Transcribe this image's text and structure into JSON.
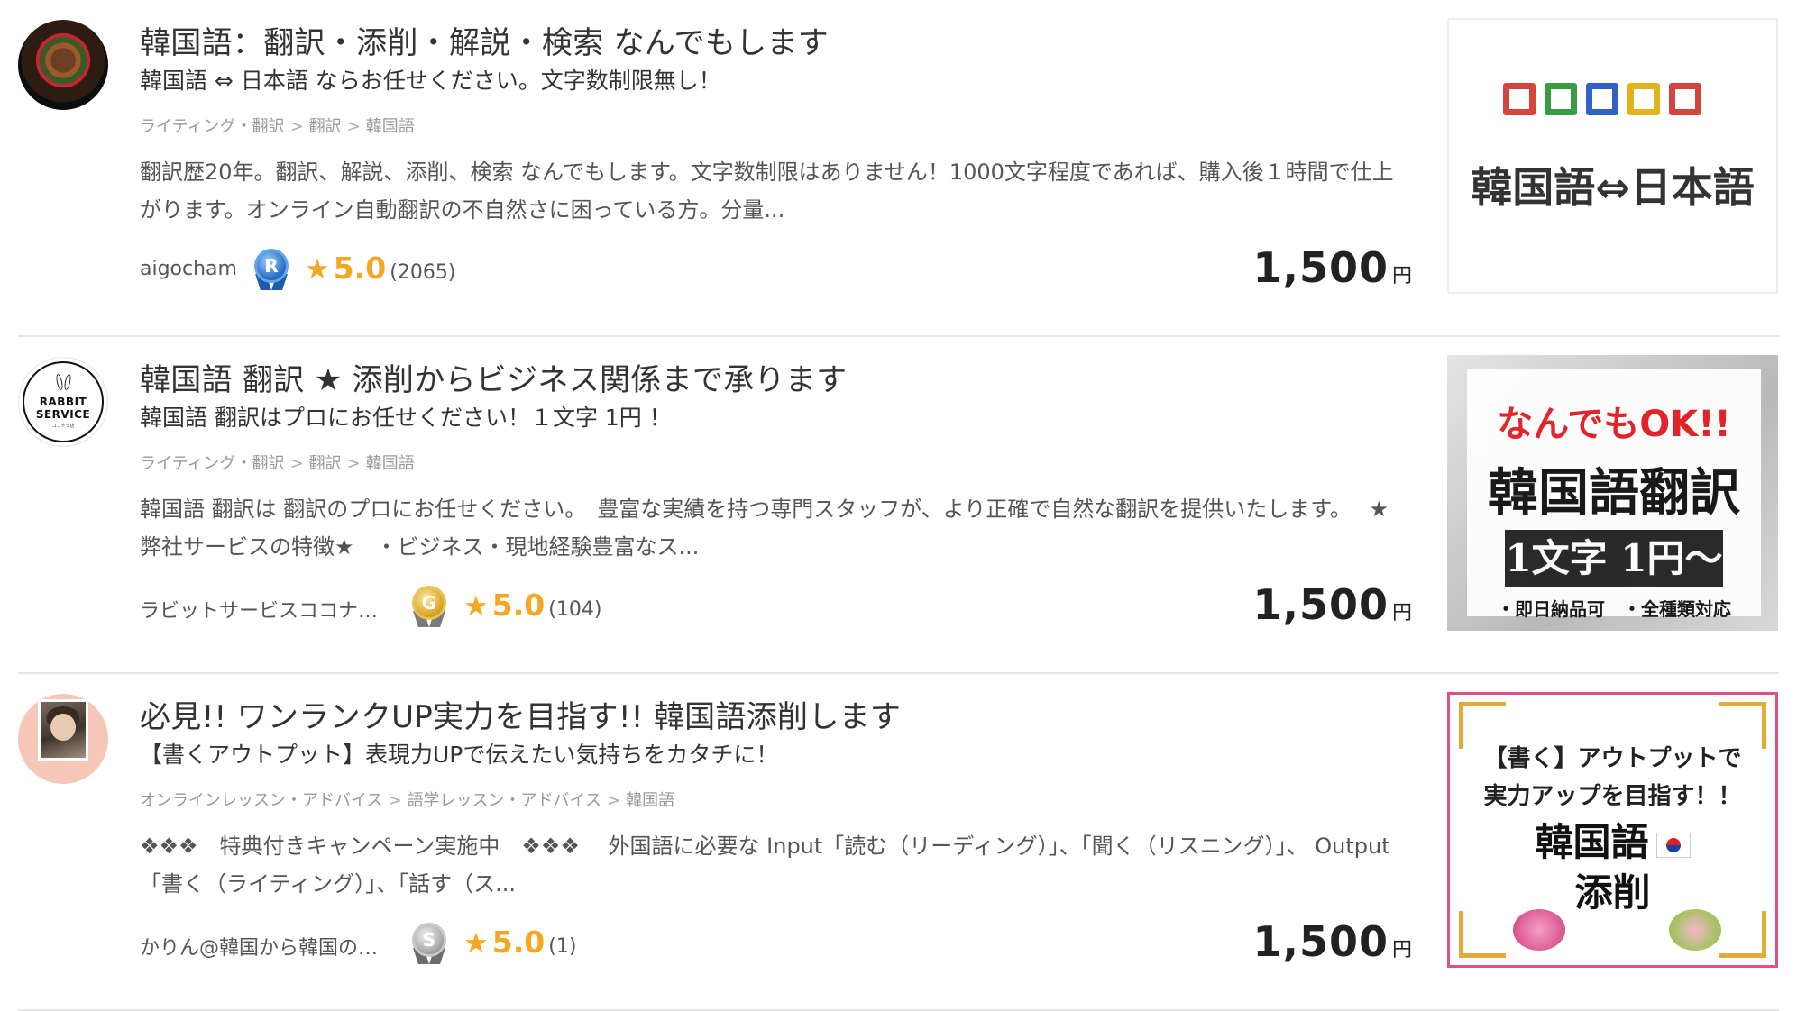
{
  "listings": [
    {
      "title": "韓国語：翻訳・添削・解説・検索 なんでもします",
      "subtitle": "韓国語 ⇔ 日本語 ならお任せください。文字数制限無し！",
      "breadcrumb": [
        "ライティング・翻訳",
        "翻訳",
        "韓国語"
      ],
      "description": "翻訳歴20年。翻訳、解説、添削、検索 なんでもします。文字数制限はありません！1000文字程度であれば、購入後１時間で仕上がります。オンライン自動翻訳の不自然さに困っている方。分量...",
      "seller": "aigocham",
      "medal_letter": "R",
      "rating": "5.0",
      "review_count": "(2065)",
      "price": "1,500",
      "currency": "円",
      "thumbnail_text": "韓国語⇔日本語"
    },
    {
      "title": "韓国語 翻訳 ★ 添削からビジネス関係まで承ります",
      "subtitle": "韓国語 翻訳はプロにお任せください！１文字 1円 ！",
      "breadcrumb": [
        "ライティング・翻訳",
        "翻訳",
        "韓国語"
      ],
      "description": "韓国語 翻訳は 翻訳のプロにお任せください。　豊富な実績を持つ専門スタッフが、より正確で自然な翻訳を提供いたします。　 ★弊社サービスの特徴★　・ビジネス・現地経験豊富なス...",
      "seller": "ラビットサービスココナ…",
      "medal_letter": "G",
      "rating": "5.0",
      "review_count": "(104)",
      "price": "1,500",
      "currency": "円",
      "avatar_text": [
        "RABBIT",
        "SERVICE",
        "ココナラ店"
      ],
      "thumbnail_text": {
        "headline": "なんでもOK!!",
        "main": "韓国語翻訳",
        "bar": "1文字 1円〜",
        "footer": "・即日納品可　・全種類対応"
      }
    },
    {
      "title": "必見!! ワンランクUP実力を目指す!! 韓国語添削します",
      "subtitle": "【書くアウトプット】表現力UPで伝えたい気持ちをカタチに！",
      "breadcrumb": [
        "オンラインレッスン・アドバイス",
        "語学レッスン・アドバイス",
        "韓国語"
      ],
      "description": "❖❖❖　特典付きキャンペーン実施中　❖❖❖　 外国語に必要な Input「読む（リーディング）」、「聞く（リスニング）」、 Output「書く（ライティング）」、「話す（ス...",
      "seller": "かりん@韓国から韓国の…",
      "medal_letter": "S",
      "rating": "5.0",
      "review_count": "(1)",
      "price": "1,500",
      "currency": "円",
      "thumbnail_text": {
        "line1": "【書く】アウトプットで",
        "line2": "実力アップを目指す！！",
        "line3": "韓国語",
        "line4": "添削"
      }
    }
  ],
  "colors": {
    "accent_star": "#f5a623",
    "price_text": "#222222",
    "breadcrumb_text": "#999999",
    "divider": "#e6e6e6"
  }
}
